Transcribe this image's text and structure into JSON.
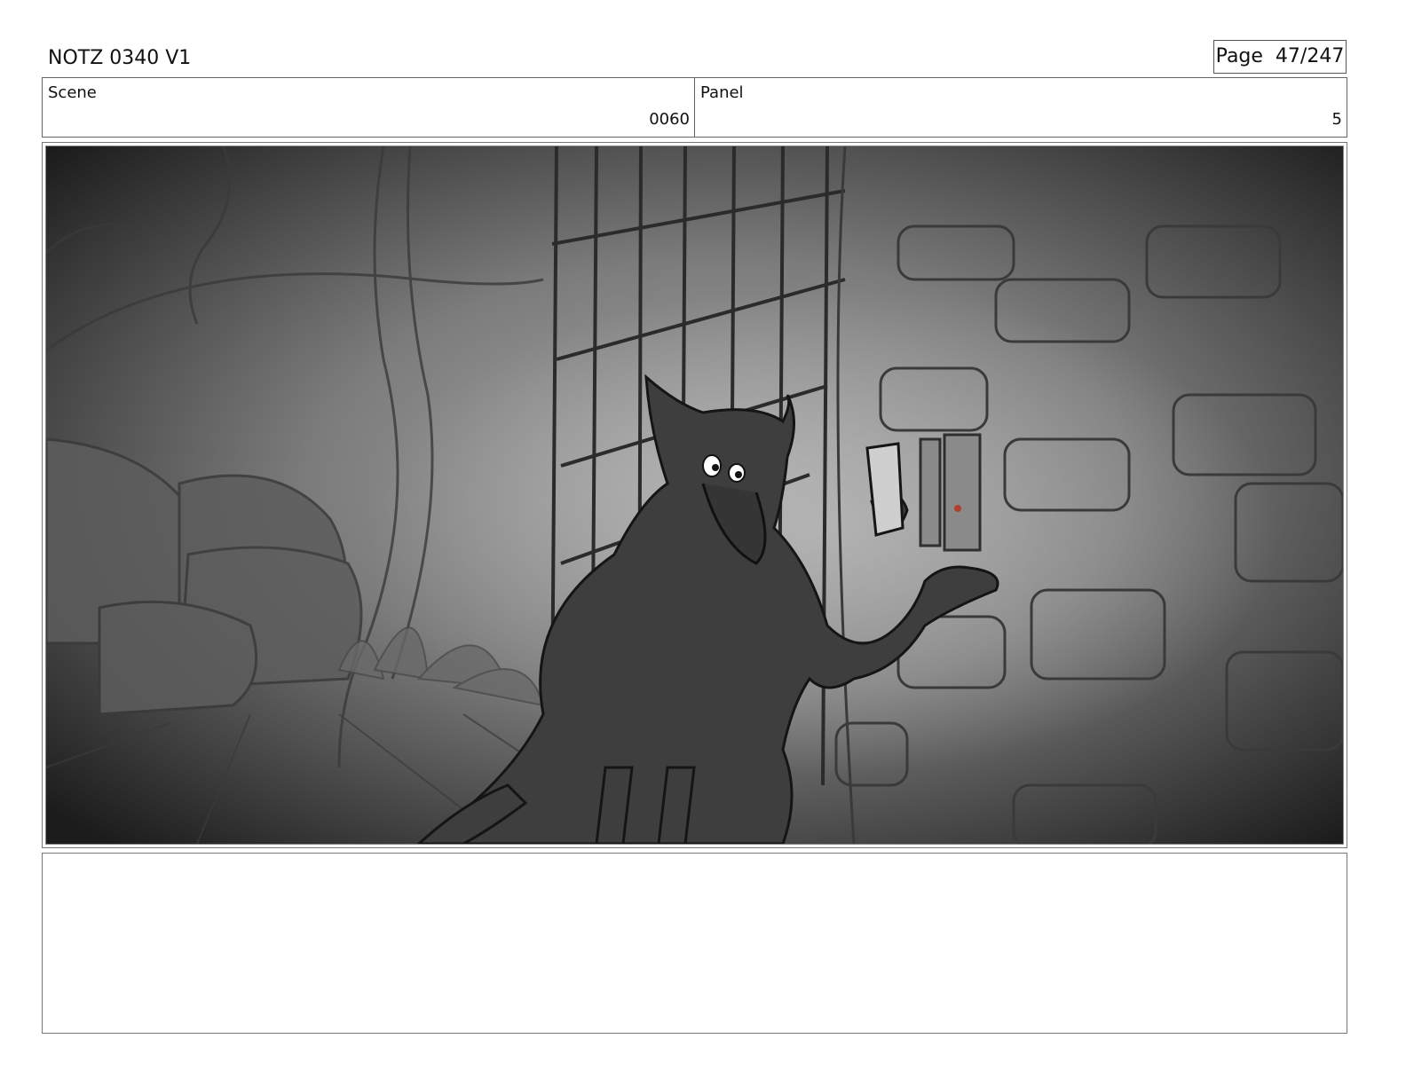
{
  "header": {
    "title": "NOTZ 0340 V1",
    "page": "Page  47/247"
  },
  "info": {
    "scene_label": "Scene",
    "scene_value": "0060",
    "panel_label": "Panel",
    "panel_value": "5"
  },
  "panel_image": {
    "description_icon": "storyboard-sketch"
  },
  "notes": {
    "text": ""
  }
}
